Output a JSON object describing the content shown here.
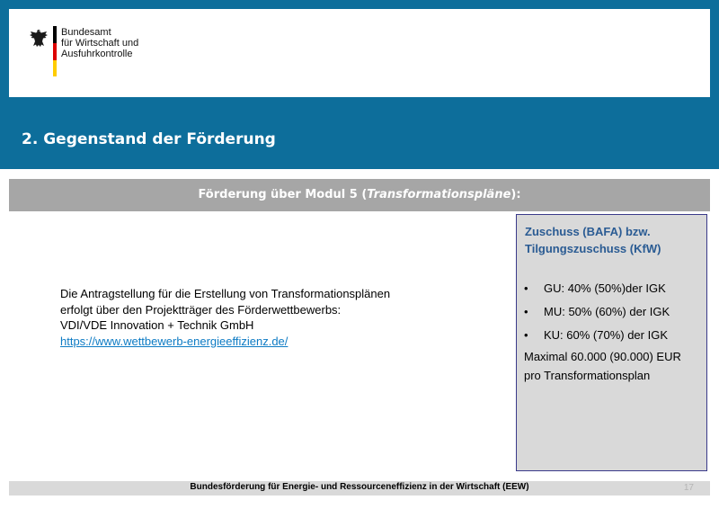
{
  "header": {
    "agency_lines": [
      "Bundesamt",
      "für Wirtschaft und",
      "Ausfuhrkontrolle"
    ],
    "logo_icon": "federal-eagle-icon",
    "flag_colors": [
      "#000000",
      "#dd0000",
      "#ffcc00"
    ]
  },
  "title": "2. Gegenstand der Förderung",
  "section_header": {
    "prefix": "Förderung über Modul 5 (",
    "emphasis": "Transformationspläne",
    "suffix": "):"
  },
  "main": {
    "lines": [
      "Die Antragstellung für  die Erstellung von Transformationsplänen",
      "erfolgt über den Projektträger des Förderwettbewerbs:",
      "VDI/VDE Innovation + Technik GmbH"
    ],
    "link": "https://www.wettbewerb-energieeffizienz.de/"
  },
  "sidebox": {
    "heading_lines": [
      "Zuschuss (BAFA) bzw.",
      "Tilgungszuschuss (KfW)"
    ],
    "bullets": [
      "GU: 40% (50%)der IGK",
      "MU: 50% (60%) der IGK",
      "KU:  60% (70%) der IGK"
    ],
    "note_lines": [
      "Maximal 60.000 (90.000) EUR",
      "pro Transformationsplan"
    ]
  },
  "footer": {
    "text": "Bundesförderung für Energie- und Ressourceneffizienz in der Wirtschaft (EEW)",
    "page_number": "17"
  },
  "colors": {
    "top_band": "#0d6e9b",
    "section_gray": "#a6a6a6",
    "sidebox_gray": "#d9d9d9",
    "heading_blue": "#2a5b93"
  }
}
